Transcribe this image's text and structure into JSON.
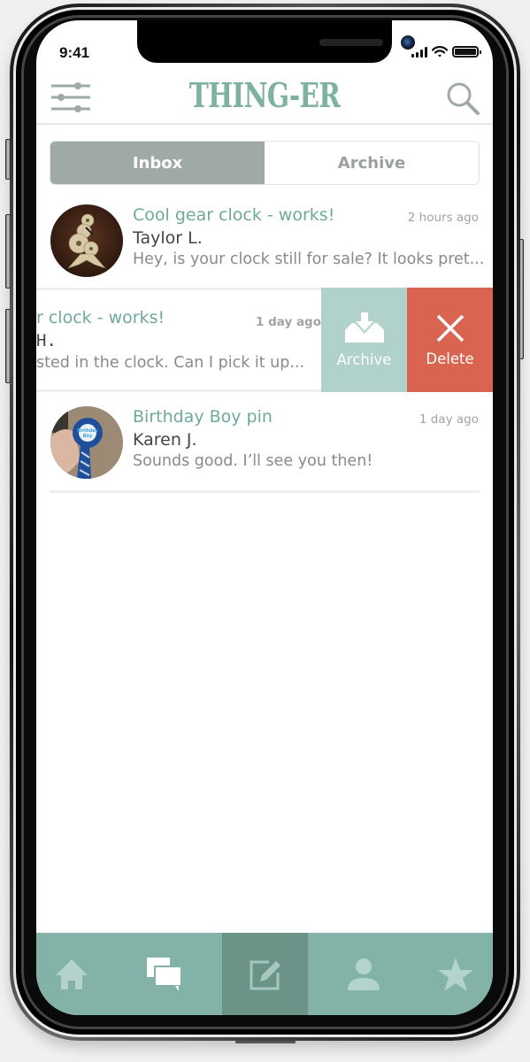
{
  "status_bar": {
    "time": "9:41",
    "signal": "signal-bars-icon",
    "wifi": "wifi-icon",
    "battery": "battery-full-icon"
  },
  "header": {
    "app_title": "THING-ER",
    "left_icon": "filter-sliders-icon",
    "right_icon": "search-icon"
  },
  "segmented": {
    "tabs": [
      {
        "label": "Inbox",
        "active": true
      },
      {
        "label": "Archive",
        "active": false
      }
    ]
  },
  "messages": [
    {
      "title": "Cool gear clock - works!",
      "time": "2 hours ago",
      "sender": "Taylor L.",
      "preview": "Hey, is your clock still for sale? It looks pret...",
      "avatar": "gear-clock-photo"
    },
    {
      "title": "Cool gear clock - works!",
      "title_visible": "r clock - works!",
      "time": "1 day ago",
      "sender_visible": "H.",
      "preview_visible": "sted in the clock. Can I pick it up...",
      "swiped": true,
      "actions": [
        {
          "label": "Archive",
          "icon": "archive-tray-icon",
          "color": "#b1d1cb"
        },
        {
          "label": "Delete",
          "icon": "close-x-icon",
          "color": "#d9644f"
        }
      ]
    },
    {
      "title": "Birthday Boy pin",
      "time": "1 day ago",
      "sender": "Karen J.",
      "preview": "Sounds good. I’ll see you then!",
      "avatar": "birthday-ribbon-photo",
      "avatar_badge_text": "Birthday Boy"
    }
  ],
  "tabbar": {
    "items": [
      {
        "name": "home",
        "icon": "home-icon",
        "active": false
      },
      {
        "name": "messages",
        "icon": "chat-bubbles-icon",
        "active": false,
        "highlighted": true
      },
      {
        "name": "compose",
        "icon": "compose-edit-icon",
        "active": true
      },
      {
        "name": "profile",
        "icon": "person-icon",
        "active": false
      },
      {
        "name": "favorites",
        "icon": "star-icon",
        "active": false
      }
    ]
  },
  "colors": {
    "brand": "#7fb1a3",
    "title_text": "#6fa99a",
    "segment_active": "#9fa9a6",
    "archive_action": "#b1d1cb",
    "delete_action": "#d9644f",
    "tabbar": "#82b2a8",
    "tabbar_active": "#6c9388"
  }
}
